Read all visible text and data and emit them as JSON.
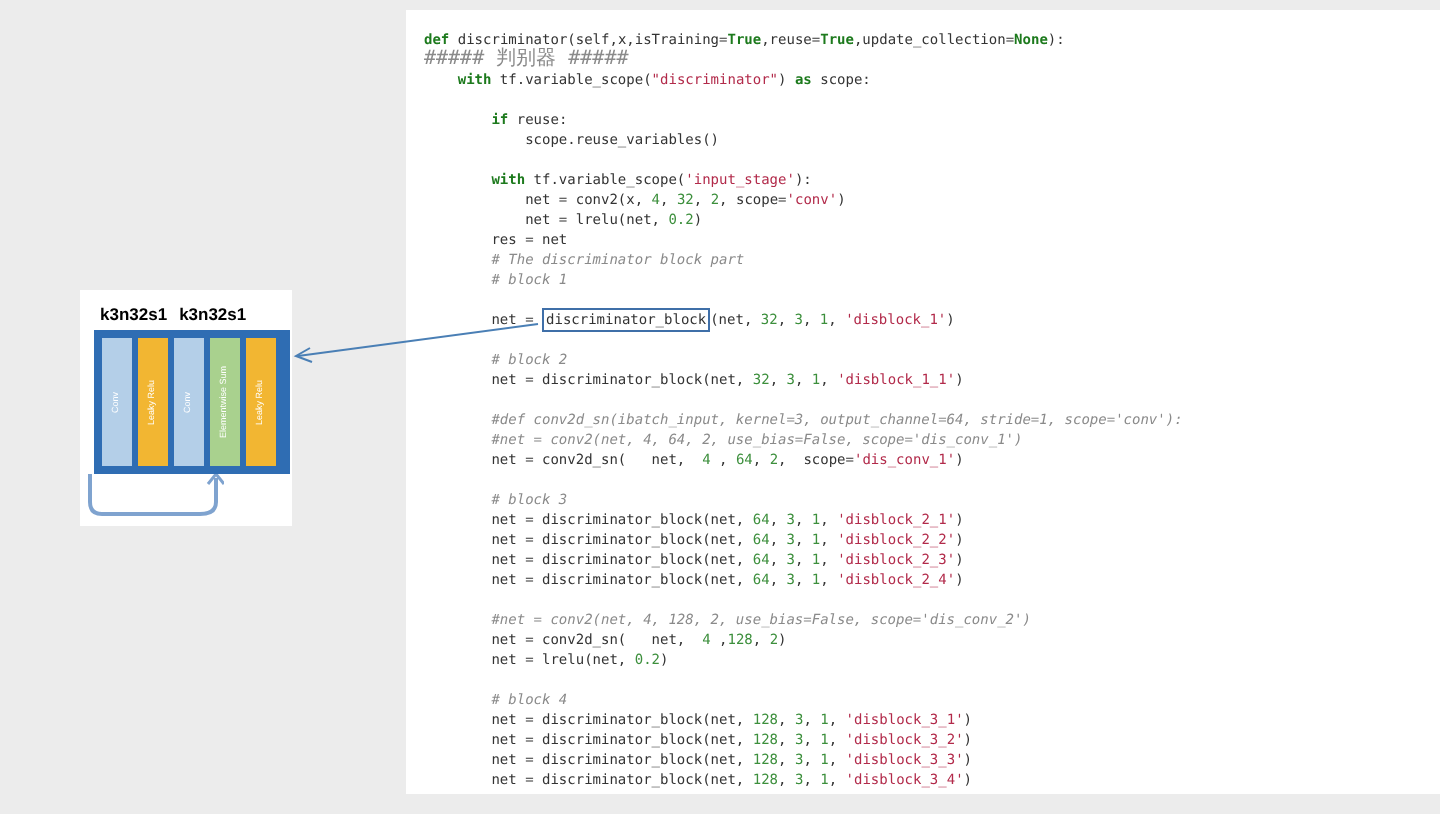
{
  "diagram": {
    "labels": [
      "k3n32s1",
      "k3n32s1"
    ],
    "layers": [
      {
        "text": "Conv",
        "color": "#b4cfe8"
      },
      {
        "text": "Leaky Relu",
        "color": "#f2b632"
      },
      {
        "text": "Conv",
        "color": "#b4cfe8"
      },
      {
        "text": "Elementwise Sum",
        "color": "#a9d18e"
      },
      {
        "text": "Leaky Relu",
        "color": "#f2b632"
      }
    ]
  },
  "code": {
    "lines": [
      {
        "kind": "code",
        "segments": [
          {
            "text": "def discriminator(self,x,isTraining=True,reuse=True,update_collection=None):",
            "boxed": false
          }
        ]
      },
      {
        "kind": "comment",
        "segments": [
          {
            "text": "##### 判别器 #####",
            "boxed": false
          }
        ]
      },
      {
        "kind": "code",
        "segments": [
          {
            "text": "    with tf.variable_scope(\"discriminator\") as scope:",
            "boxed": false
          }
        ]
      },
      {
        "kind": "blank"
      },
      {
        "kind": "code",
        "segments": [
          {
            "text": "        if reuse:",
            "boxed": false
          }
        ]
      },
      {
        "kind": "code",
        "segments": [
          {
            "text": "            scope.reuse_variables()",
            "boxed": false
          }
        ]
      },
      {
        "kind": "blank"
      },
      {
        "kind": "code",
        "segments": [
          {
            "text": "        with tf.variable_scope('input_stage'):",
            "boxed": false
          }
        ]
      },
      {
        "kind": "code",
        "segments": [
          {
            "text": "            net = conv2(x, 4, 32, 2, scope='conv')",
            "boxed": false
          }
        ]
      },
      {
        "kind": "code",
        "segments": [
          {
            "text": "            net = lrelu(net, 0.2)",
            "boxed": false
          }
        ]
      },
      {
        "kind": "code",
        "segments": [
          {
            "text": "        res = net",
            "boxed": false
          }
        ]
      },
      {
        "kind": "comment",
        "segments": [
          {
            "text": "        # The discriminator block part",
            "boxed": false
          }
        ]
      },
      {
        "kind": "comment",
        "segments": [
          {
            "text": "        # block 1",
            "boxed": false
          }
        ]
      },
      {
        "kind": "blank"
      },
      {
        "kind": "code",
        "segments": [
          {
            "text": "        net = ",
            "boxed": false
          },
          {
            "text": "discriminator_block",
            "boxed": true
          },
          {
            "text": "(net, 32, 3, 1, 'disblock_1')",
            "boxed": false
          }
        ]
      },
      {
        "kind": "blank"
      },
      {
        "kind": "comment",
        "segments": [
          {
            "text": "        # block 2",
            "boxed": false
          }
        ]
      },
      {
        "kind": "code",
        "segments": [
          {
            "text": "        net = discriminator_block(net, 32, 3, 1, 'disblock_1_1')",
            "boxed": false
          }
        ]
      },
      {
        "kind": "blank"
      },
      {
        "kind": "comment",
        "segments": [
          {
            "text": "        #def conv2d_sn(ibatch_input, kernel=3, output_channel=64, stride=1, scope='conv'):",
            "boxed": false
          }
        ]
      },
      {
        "kind": "comment",
        "segments": [
          {
            "text": "        #net = conv2(net, 4, 64, 2, use_bias=False, scope='dis_conv_1')",
            "boxed": false
          }
        ]
      },
      {
        "kind": "code",
        "segments": [
          {
            "text": "        net = conv2d_sn(   net,  4 , 64, 2,  scope='dis_conv_1')",
            "boxed": false
          }
        ]
      },
      {
        "kind": "blank"
      },
      {
        "kind": "comment",
        "segments": [
          {
            "text": "        # block 3",
            "boxed": false
          }
        ]
      },
      {
        "kind": "code",
        "segments": [
          {
            "text": "        net = discriminator_block(net, 64, 3, 1, 'disblock_2_1')",
            "boxed": false
          }
        ]
      },
      {
        "kind": "code",
        "segments": [
          {
            "text": "        net = discriminator_block(net, 64, 3, 1, 'disblock_2_2')",
            "boxed": false
          }
        ]
      },
      {
        "kind": "code",
        "segments": [
          {
            "text": "        net = discriminator_block(net, 64, 3, 1, 'disblock_2_3')",
            "boxed": false
          }
        ]
      },
      {
        "kind": "code",
        "segments": [
          {
            "text": "        net = discriminator_block(net, 64, 3, 1, 'disblock_2_4')",
            "boxed": false
          }
        ]
      },
      {
        "kind": "blank"
      },
      {
        "kind": "comment",
        "segments": [
          {
            "text": "        #net = conv2(net, 4, 128, 2, use_bias=False, scope='dis_conv_2')",
            "boxed": false
          }
        ]
      },
      {
        "kind": "code",
        "segments": [
          {
            "text": "        net = conv2d_sn(   net,  4 ,128, 2)",
            "boxed": false
          }
        ]
      },
      {
        "kind": "code",
        "segments": [
          {
            "text": "        net = lrelu(net, 0.2)",
            "boxed": false
          }
        ]
      },
      {
        "kind": "blank"
      },
      {
        "kind": "comment",
        "segments": [
          {
            "text": "        # block 4",
            "boxed": false
          }
        ]
      },
      {
        "kind": "code",
        "segments": [
          {
            "text": "        net = discriminator_block(net, 128, 3, 1, 'disblock_3_1')",
            "boxed": false
          }
        ]
      },
      {
        "kind": "code",
        "segments": [
          {
            "text": "        net = discriminator_block(net, 128, 3, 1, 'disblock_3_2')",
            "boxed": false
          }
        ]
      },
      {
        "kind": "code",
        "segments": [
          {
            "text": "        net = discriminator_block(net, 128, 3, 1, 'disblock_3_3')",
            "boxed": false
          }
        ]
      },
      {
        "kind": "code",
        "segments": [
          {
            "text": "        net = discriminator_block(net, 128, 3, 1, 'disblock_3_4')",
            "boxed": false
          }
        ]
      }
    ]
  }
}
